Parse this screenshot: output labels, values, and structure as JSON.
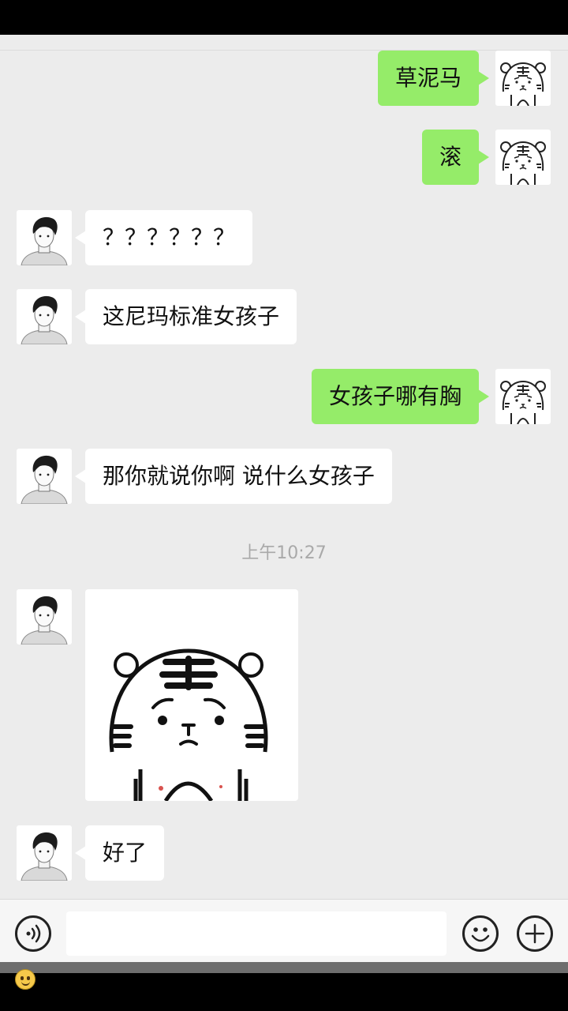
{
  "chat": {
    "messages": [
      {
        "id": "m1",
        "direction": "out",
        "text": "草泥马"
      },
      {
        "id": "m2",
        "direction": "out",
        "text": "滚"
      },
      {
        "id": "m3",
        "direction": "in",
        "text": "？？？？？？"
      },
      {
        "id": "m4",
        "direction": "in",
        "text": "这尼玛标准女孩子"
      },
      {
        "id": "m5",
        "direction": "out",
        "text": "女孩子哪有胸"
      },
      {
        "id": "m6",
        "direction": "in",
        "text": "那你就说你啊 说什么女孩子"
      },
      {
        "id": "m7",
        "direction": "in",
        "type": "sticker",
        "sticker": "sad-tiger-sticker"
      },
      {
        "id": "m8",
        "direction": "in",
        "text": "好了"
      }
    ],
    "timestamp": "上午10:27"
  },
  "input_bar": {
    "text_value": "",
    "voice_icon": "voice-icon",
    "emoji_icon": "emoji-icon",
    "add_icon": "plus-icon"
  },
  "colors": {
    "background": "#ececec",
    "outgoing_bubble": "#95ec69",
    "incoming_bubble": "#ffffff",
    "timestamp": "#a9a9a9"
  }
}
